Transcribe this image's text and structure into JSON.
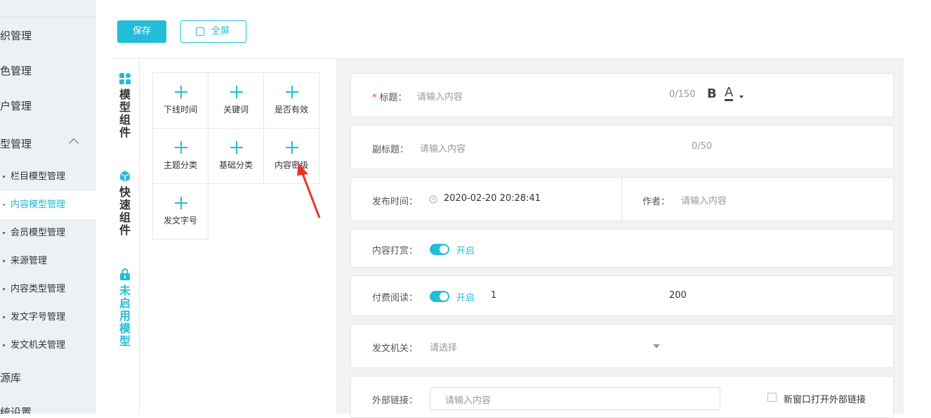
{
  "sidebar": {
    "items": [
      {
        "label": "织管理"
      },
      {
        "label": "色管理"
      },
      {
        "label": "户管理"
      },
      {
        "label": "型管理"
      },
      {
        "label": "源库"
      },
      {
        "label": "统设置"
      }
    ],
    "sub_items": [
      {
        "label": "栏目模型管理"
      },
      {
        "label": "内容模型管理"
      },
      {
        "label": "会员模型管理"
      },
      {
        "label": "来源管理"
      },
      {
        "label": "内容类型管理"
      },
      {
        "label": "发文字号管理"
      },
      {
        "label": "发文机关管理"
      }
    ]
  },
  "toolbar": {
    "save_label": "保存",
    "fullscreen_label": "全屏"
  },
  "tabs": [
    {
      "label": "模型组件",
      "icon": "widgets-icon"
    },
    {
      "label": "快速组件",
      "icon": "cube-icon"
    },
    {
      "label": "未启用模型",
      "icon": "lock-icon"
    }
  ],
  "components": [
    {
      "label": "下线时间"
    },
    {
      "label": "关键词"
    },
    {
      "label": "是否有效"
    },
    {
      "label": "主题分类"
    },
    {
      "label": "基础分类"
    },
    {
      "label": "内容密级"
    },
    {
      "label": "发文字号"
    }
  ],
  "form": {
    "title": {
      "required_mark": "*",
      "label": "标题：",
      "placeholder": "请输入内容",
      "counter": "0/150",
      "bold": "B",
      "color": "A"
    },
    "subtitle": {
      "label": "副标题：",
      "placeholder": "请输入内容",
      "counter": "0/50"
    },
    "publish_time": {
      "label": "发布时间：",
      "value": "2020-02-20 20:28:41"
    },
    "author": {
      "label": "作者：",
      "placeholder": "请输入内容"
    },
    "reward": {
      "label": "内容打赏：",
      "status": "开启"
    },
    "paid_read": {
      "label": "付费阅读：",
      "status": "开启",
      "value1": "1",
      "value2": "200"
    },
    "issuer": {
      "label": "发文机关：",
      "placeholder": "请选择"
    },
    "external_link": {
      "label": "外部链接：",
      "placeholder": "请输入内容",
      "checkbox_label": "新窗口打开外部链接"
    }
  },
  "colors": {
    "accent": "#23bdd8",
    "required": "#ee3333",
    "annotation_arrow": "#e8332f"
  }
}
